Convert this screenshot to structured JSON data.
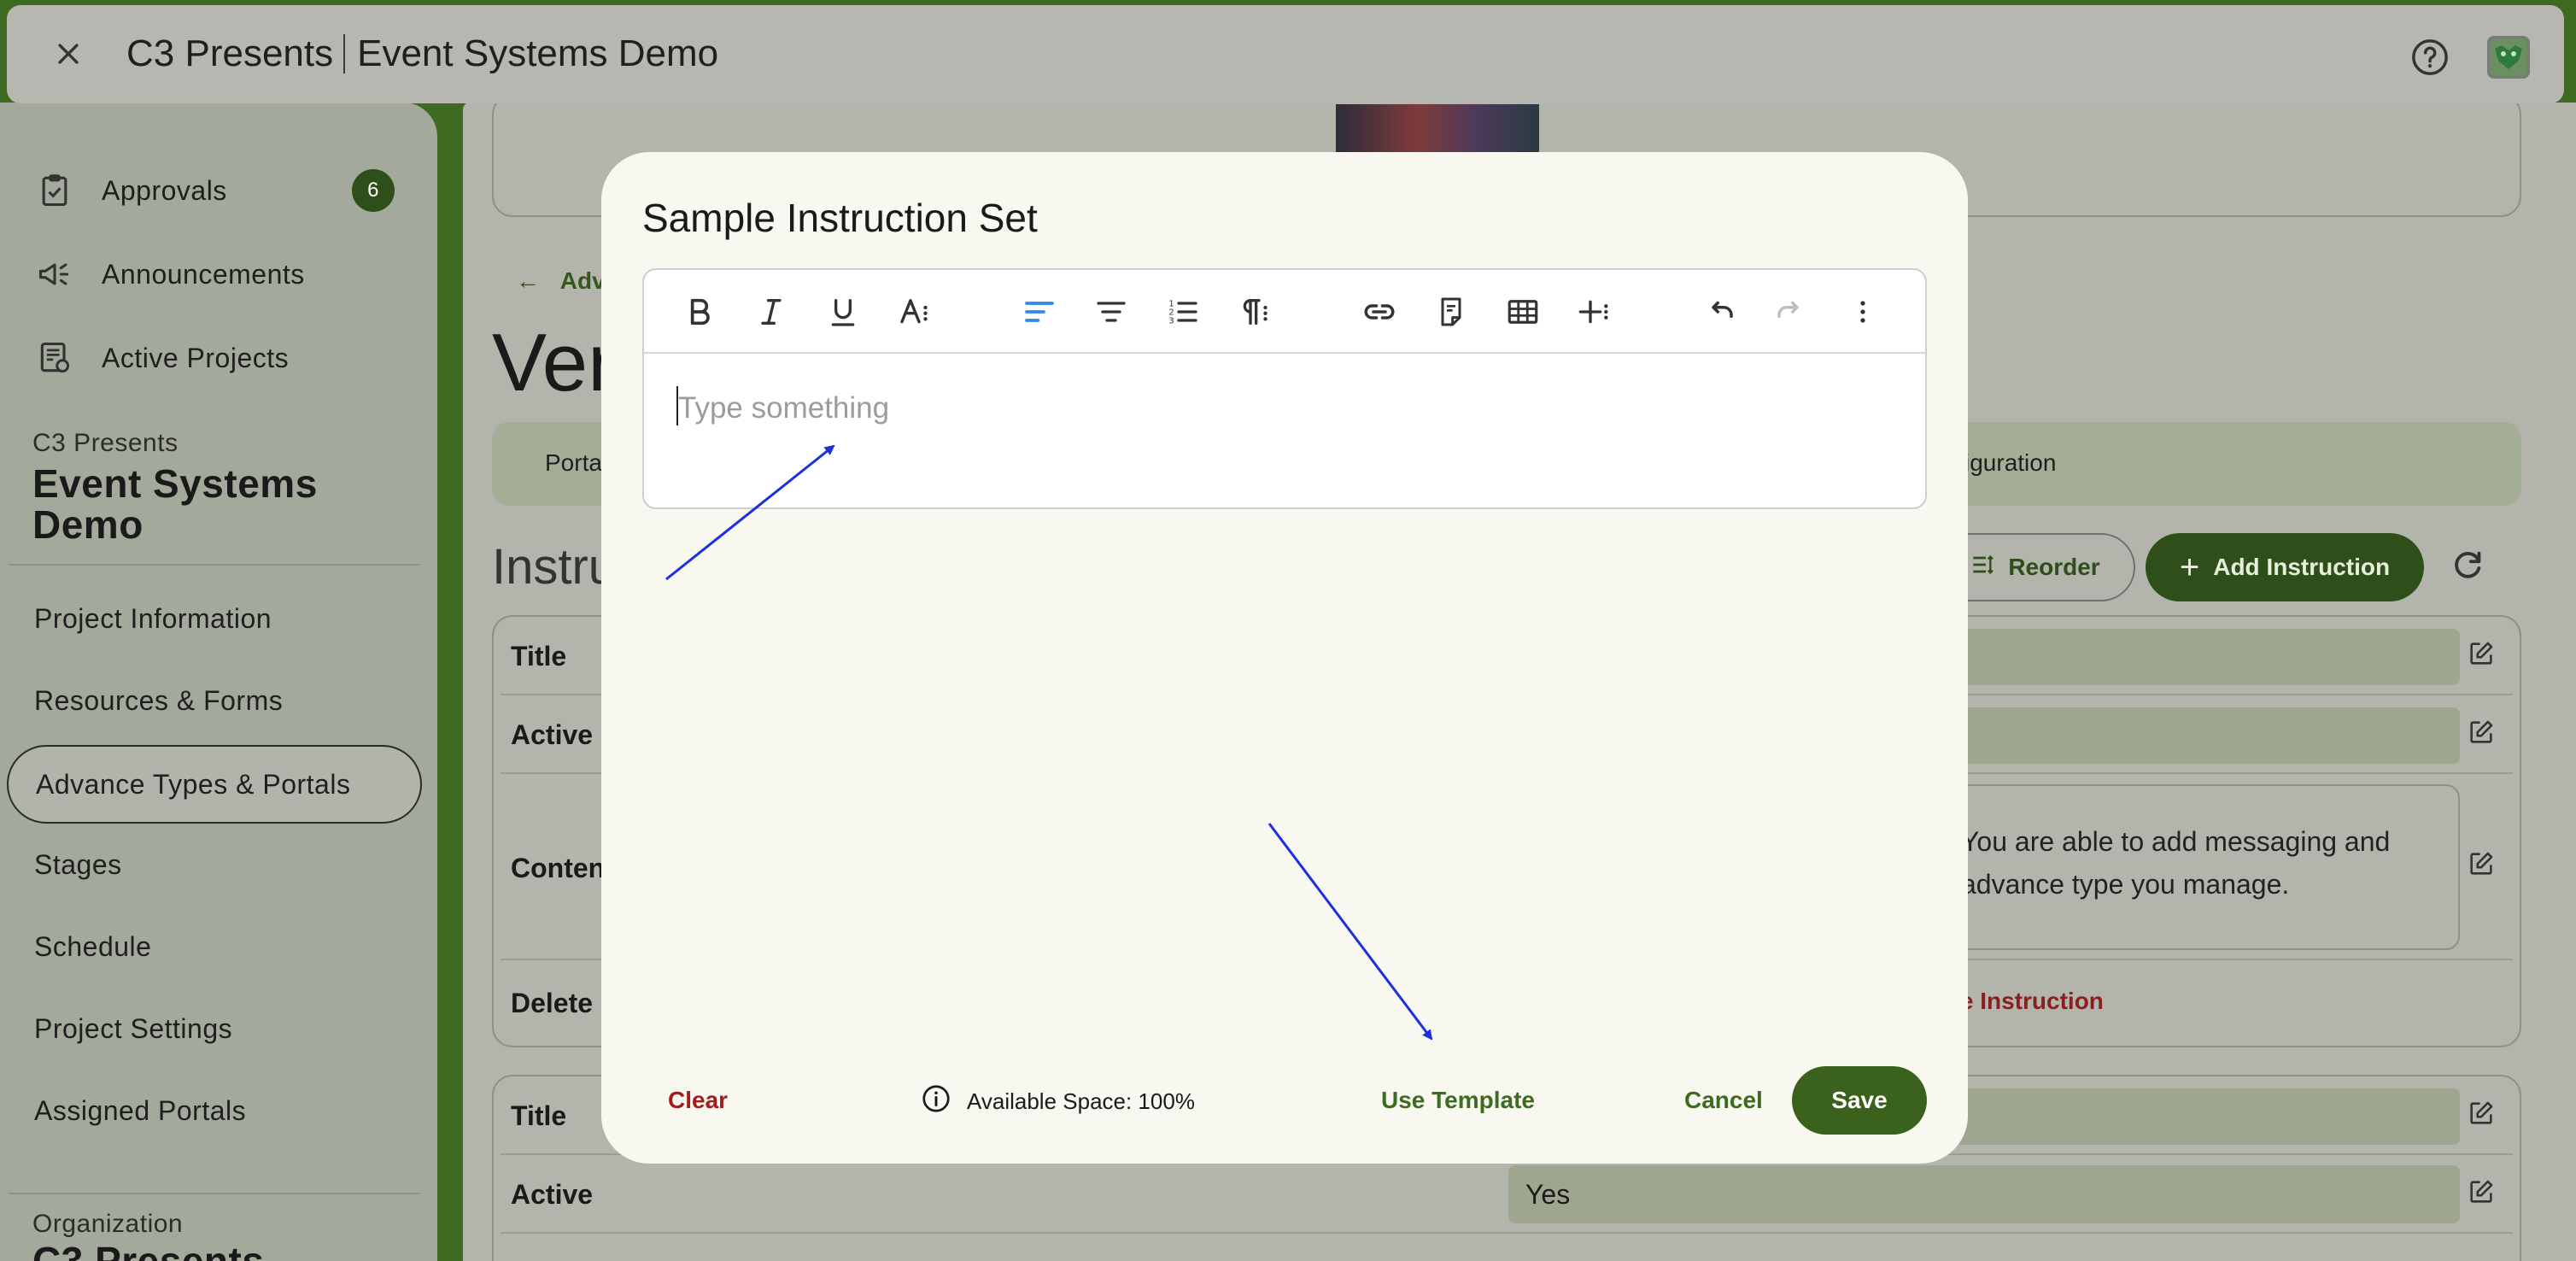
{
  "app": {
    "org_name": "C3 Presents",
    "project_name": "Event Systems Demo"
  },
  "sidebar": {
    "top_items": [
      {
        "label": "Approvals",
        "badge": "6",
        "icon": "clipboard-check-icon"
      },
      {
        "label": "Announcements",
        "icon": "megaphone-icon"
      },
      {
        "label": "Active Projects",
        "icon": "projects-icon"
      }
    ],
    "project_org": "C3 Presents",
    "project_title_line1": "Event Systems",
    "project_title_line2": "Demo",
    "project_items": [
      "Project Information",
      "Resources & Forms",
      "Advance Types & Portals",
      "Stages",
      "Schedule",
      "Project Settings",
      "Assigned Portals"
    ],
    "active_item": "Advance Types & Portals",
    "org_section_label": "Organization",
    "org_section_title": "C3 Presents"
  },
  "page": {
    "back_link": "Adva",
    "title_partial": "Ver",
    "tab_left": "Porta",
    "tab_right": "iguration",
    "section_heading": "Instru",
    "reorder_label": "Reorder",
    "add_label": "Add Instruction",
    "rows": {
      "title": "Title",
      "active": "Active",
      "content": "Content",
      "delete": "Delete"
    },
    "content_line1": "You are able to add messaging and",
    "content_line2": "advance type you manage.",
    "delete_partial": "ete Instruction",
    "active_value": "Yes"
  },
  "modal": {
    "title": "Sample Instruction Set",
    "placeholder": "Type something",
    "toolbar": [
      "bold-icon",
      "italic-icon",
      "underline-icon",
      "text-size-icon",
      "align-left-icon",
      "align-center-icon",
      "numbered-list-icon",
      "paragraph-icon",
      "link-icon",
      "insert-document-icon",
      "table-icon",
      "insert-more-icon",
      "undo-icon",
      "redo-icon",
      "more-vertical-icon"
    ],
    "clear_label": "Clear",
    "available_space": "Available Space: 100%",
    "use_template_label": "Use Template",
    "cancel_label": "Cancel",
    "save_label": "Save"
  },
  "colors": {
    "brand_green": "#3a621c",
    "danger_red": "#a01d1d",
    "annotation_blue": "#1a2fe0"
  }
}
